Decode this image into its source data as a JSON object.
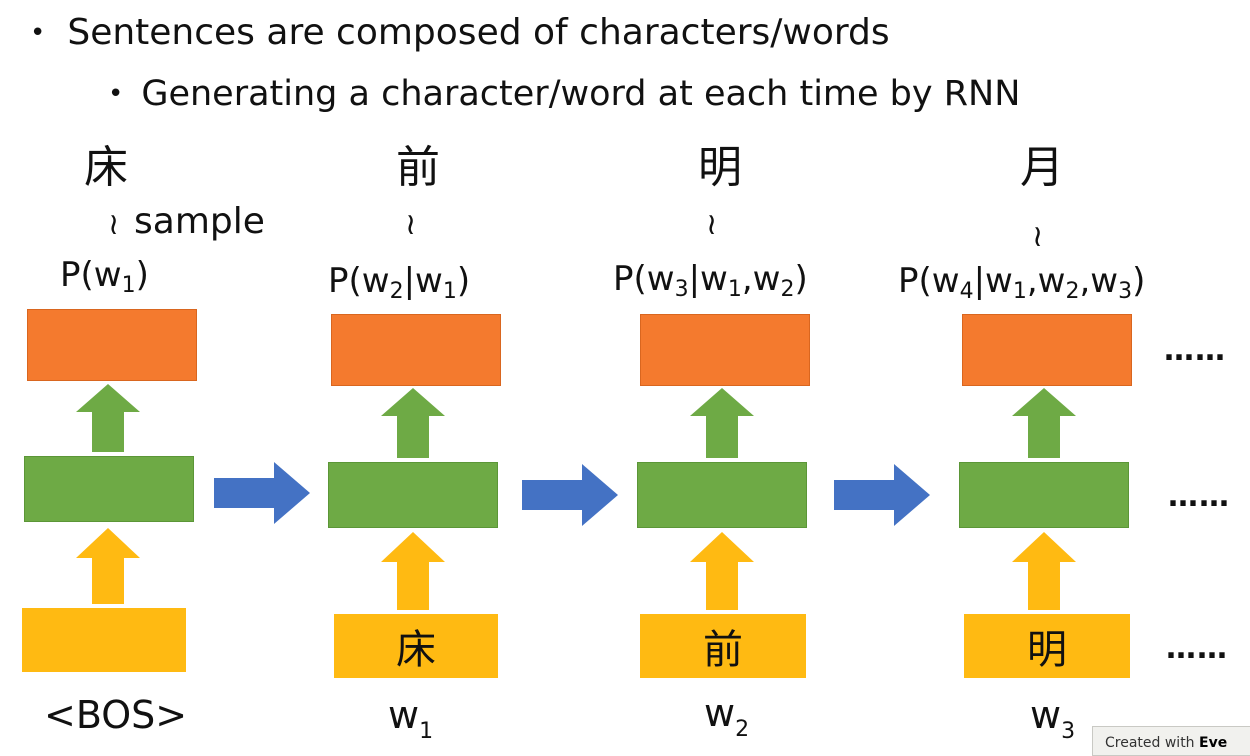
{
  "bullets": {
    "level1": "Sentences are composed of characters/words",
    "level2": "Generating a character/word at each time by RNN"
  },
  "tilde": "≀",
  "sample_label": "sample",
  "steps": [
    {
      "output_char": "床",
      "prob_main": "P(w",
      "prob_sub": "1",
      "prob_rest": ")",
      "input_char": "",
      "input_label": "<BOS>"
    },
    {
      "output_char": "前",
      "input_char": "床",
      "input_label_main": "w",
      "input_label_sub": "1"
    },
    {
      "output_char": "明",
      "input_char": "前",
      "input_label_main": "w",
      "input_label_sub": "2"
    },
    {
      "output_char": "月",
      "input_char": "明",
      "input_label_main": "w",
      "input_label_sub": "3"
    }
  ],
  "continuation": "……",
  "colors": {
    "output_layer": "#F47A2E",
    "hidden_layer": "#6EAA45",
    "input_layer": "#FFBA12",
    "recurrent_arrow": "#4472C4",
    "up_arrow_green": "#6EAA45",
    "up_arrow_yellow": "#FFBA12"
  },
  "watermark": {
    "prefix": "Created with",
    "brand": "Eve"
  }
}
